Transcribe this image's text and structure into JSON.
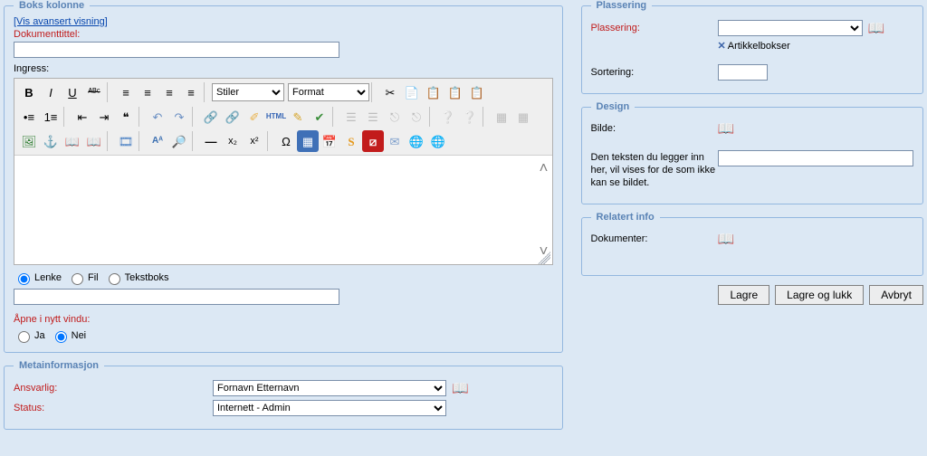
{
  "left": {
    "boks": {
      "legend": "Boks kolonne",
      "vis_avansert": "[Vis avansert visning]",
      "doktittel_label": "Dokumenttittel:",
      "doktittel_value": "",
      "ingress_label": "Ingress:",
      "stiler_label": "Stiler",
      "format_label": "Format",
      "radio": {
        "lenke": "Lenke",
        "fil": "Fil",
        "tekstboks": "Tekstboks"
      },
      "link_field_value": "",
      "nytt_vindu_label": "Åpne i nytt vindu:",
      "ja": "Ja",
      "nei": "Nei"
    },
    "meta": {
      "legend": "Metainformasjon",
      "ansvarlig_label": "Ansvarlig:",
      "ansvarlig_value": "Fornavn Etternavn",
      "status_label": "Status:",
      "status_value": "Internett - Admin"
    }
  },
  "right": {
    "plassering": {
      "legend": "Plassering",
      "plassering_label": "Plassering:",
      "artikkelbokser": "Artikkelbokser",
      "sortering_label": "Sortering:",
      "sortering_value": ""
    },
    "design": {
      "legend": "Design",
      "bilde_label": "Bilde:",
      "hint": "Den teksten du legger inn her, vil vises for de som ikke kan se bildet.",
      "alt_value": ""
    },
    "relatert": {
      "legend": "Relatert info",
      "dokumenter_label": "Dokumenter:"
    },
    "buttons": {
      "lagre": "Lagre",
      "lagre_lukk": "Lagre og lukk",
      "avbryt": "Avbryt"
    }
  },
  "icons": {
    "super": "x²",
    "sub": "x₂",
    "omega": "Ω",
    "html": "HTML",
    "s": "S",
    "cut": "✂",
    "copy": "📄",
    "paste1": "📋",
    "paste2": "📋",
    "paste3": "📋",
    "undo": "↶",
    "redo": "↷",
    "link": "🔗",
    "unlink": "🔗",
    "anchor": "⚓",
    "image": "🖼",
    "media": "🎞",
    "hr": "—",
    "table": "▦",
    "abc": "ᴬᴮᶜ",
    "bold": "B",
    "italic": "I",
    "underline": "U",
    "left": "≡",
    "center": "≡",
    "right": "≡",
    "justify": "≡",
    "ul": "•≡",
    "ol": "1≡",
    "out": "⇤",
    "in": "⇥",
    "quote": "❝",
    "tick": "✔",
    "pencil": "✎",
    "brush": "✐",
    "flash": "⧄",
    "envelope": "✉",
    "globe": "🌐",
    "help": "❔",
    "code": "</>",
    "calc": "📅",
    "node": "⎋",
    "tree": "☰",
    "find": "Aᴬ",
    "replace": "🔎",
    "book_open": "📖"
  }
}
